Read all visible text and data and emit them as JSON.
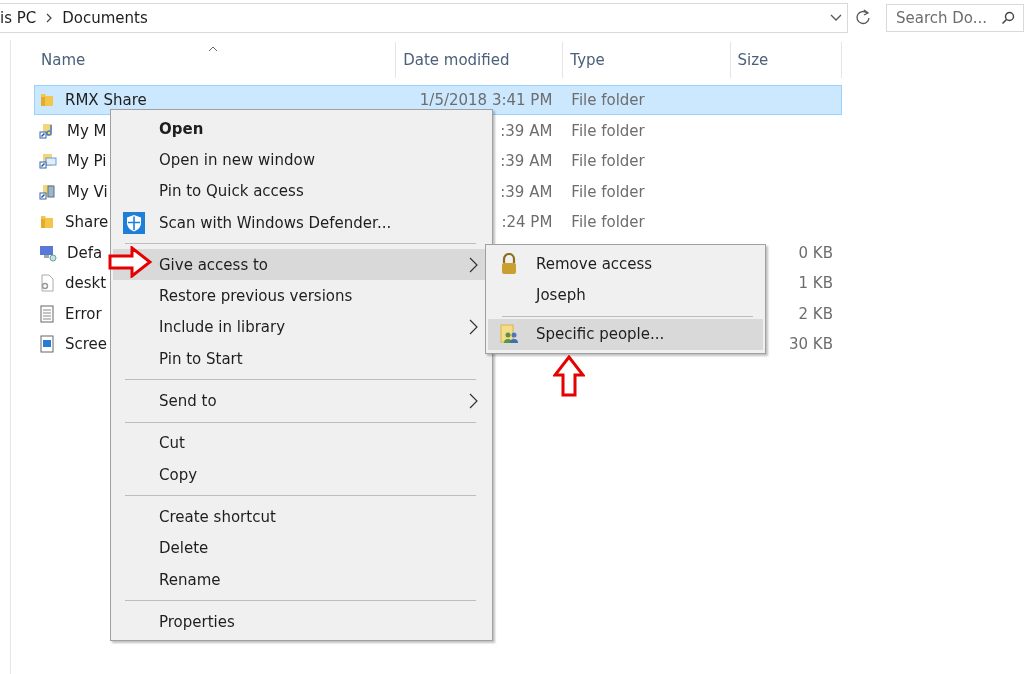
{
  "address_bar": {
    "path": [
      "is PC",
      "Documents"
    ]
  },
  "search": {
    "placeholder": "Search Do..."
  },
  "table": {
    "columns": [
      "Name",
      "Date modified",
      "Type",
      "Size"
    ],
    "rows": [
      {
        "kind": "folder",
        "name": "RMX Share",
        "date": "1/5/2018 3:41 PM",
        "type": "File folder",
        "selected": true
      },
      {
        "kind": "music",
        "name": "My M",
        "date": ":39 AM",
        "type": "File folder",
        "selected": false
      },
      {
        "kind": "pictures",
        "name": "My Pi",
        "date": ":39 AM",
        "type": "File folder",
        "selected": false
      },
      {
        "kind": "videos",
        "name": "My Vi",
        "date": ":39 AM",
        "type": "File folder",
        "selected": false
      },
      {
        "kind": "folder",
        "name": "Share",
        "date": ":24 PM",
        "type": "File folder",
        "selected": false
      },
      {
        "kind": "computer",
        "name": "Defa",
        "size": "0 KB",
        "selected": false
      },
      {
        "kind": "settings",
        "name": "deskt",
        "size": "1 KB",
        "selected": false
      },
      {
        "kind": "text",
        "name": "Error",
        "size": "2 KB",
        "selected": false
      },
      {
        "kind": "image",
        "name": "Scree",
        "size": "30 KB",
        "selected": false
      }
    ]
  },
  "context_menu": {
    "groups": [
      [
        {
          "kind": "plain",
          "label": "Open",
          "default": true,
          "submenu": false,
          "selected": false
        },
        {
          "kind": "plain",
          "label": "Open in new window",
          "default": false,
          "submenu": false,
          "selected": false
        },
        {
          "kind": "plain",
          "label": "Pin to Quick access",
          "default": false,
          "submenu": false,
          "selected": false
        },
        {
          "kind": "shield",
          "label": "Scan with Windows Defender...",
          "default": false,
          "submenu": false,
          "selected": false
        }
      ],
      [
        {
          "kind": "plain",
          "label": "Give access to",
          "default": false,
          "submenu": true,
          "selected": true
        },
        {
          "kind": "plain",
          "label": "Restore previous versions",
          "default": false,
          "submenu": false,
          "selected": false
        },
        {
          "kind": "plain",
          "label": "Include in library",
          "default": false,
          "submenu": true,
          "selected": false
        },
        {
          "kind": "plain",
          "label": "Pin to Start",
          "default": false,
          "submenu": false,
          "selected": false
        }
      ],
      [
        {
          "kind": "plain",
          "label": "Send to",
          "default": false,
          "submenu": true,
          "selected": false
        }
      ],
      [
        {
          "kind": "plain",
          "label": "Cut",
          "default": false,
          "submenu": false,
          "selected": false
        },
        {
          "kind": "plain",
          "label": "Copy",
          "default": false,
          "submenu": false,
          "selected": false
        }
      ],
      [
        {
          "kind": "plain",
          "label": "Create shortcut",
          "default": false,
          "submenu": false,
          "selected": false
        },
        {
          "kind": "plain",
          "label": "Delete",
          "default": false,
          "submenu": false,
          "selected": false
        },
        {
          "kind": "plain",
          "label": "Rename",
          "default": false,
          "submenu": false,
          "selected": false
        }
      ],
      [
        {
          "kind": "plain",
          "label": "Properties",
          "default": false,
          "submenu": false,
          "selected": false
        }
      ]
    ]
  },
  "submenu": {
    "groups": [
      [
        {
          "kind": "lock",
          "label": "Remove access",
          "selected": false
        },
        {
          "kind": "plain",
          "label": "Joseph",
          "selected": false
        }
      ],
      [
        {
          "kind": "people",
          "label": "Specific people...",
          "selected": true
        }
      ]
    ]
  }
}
